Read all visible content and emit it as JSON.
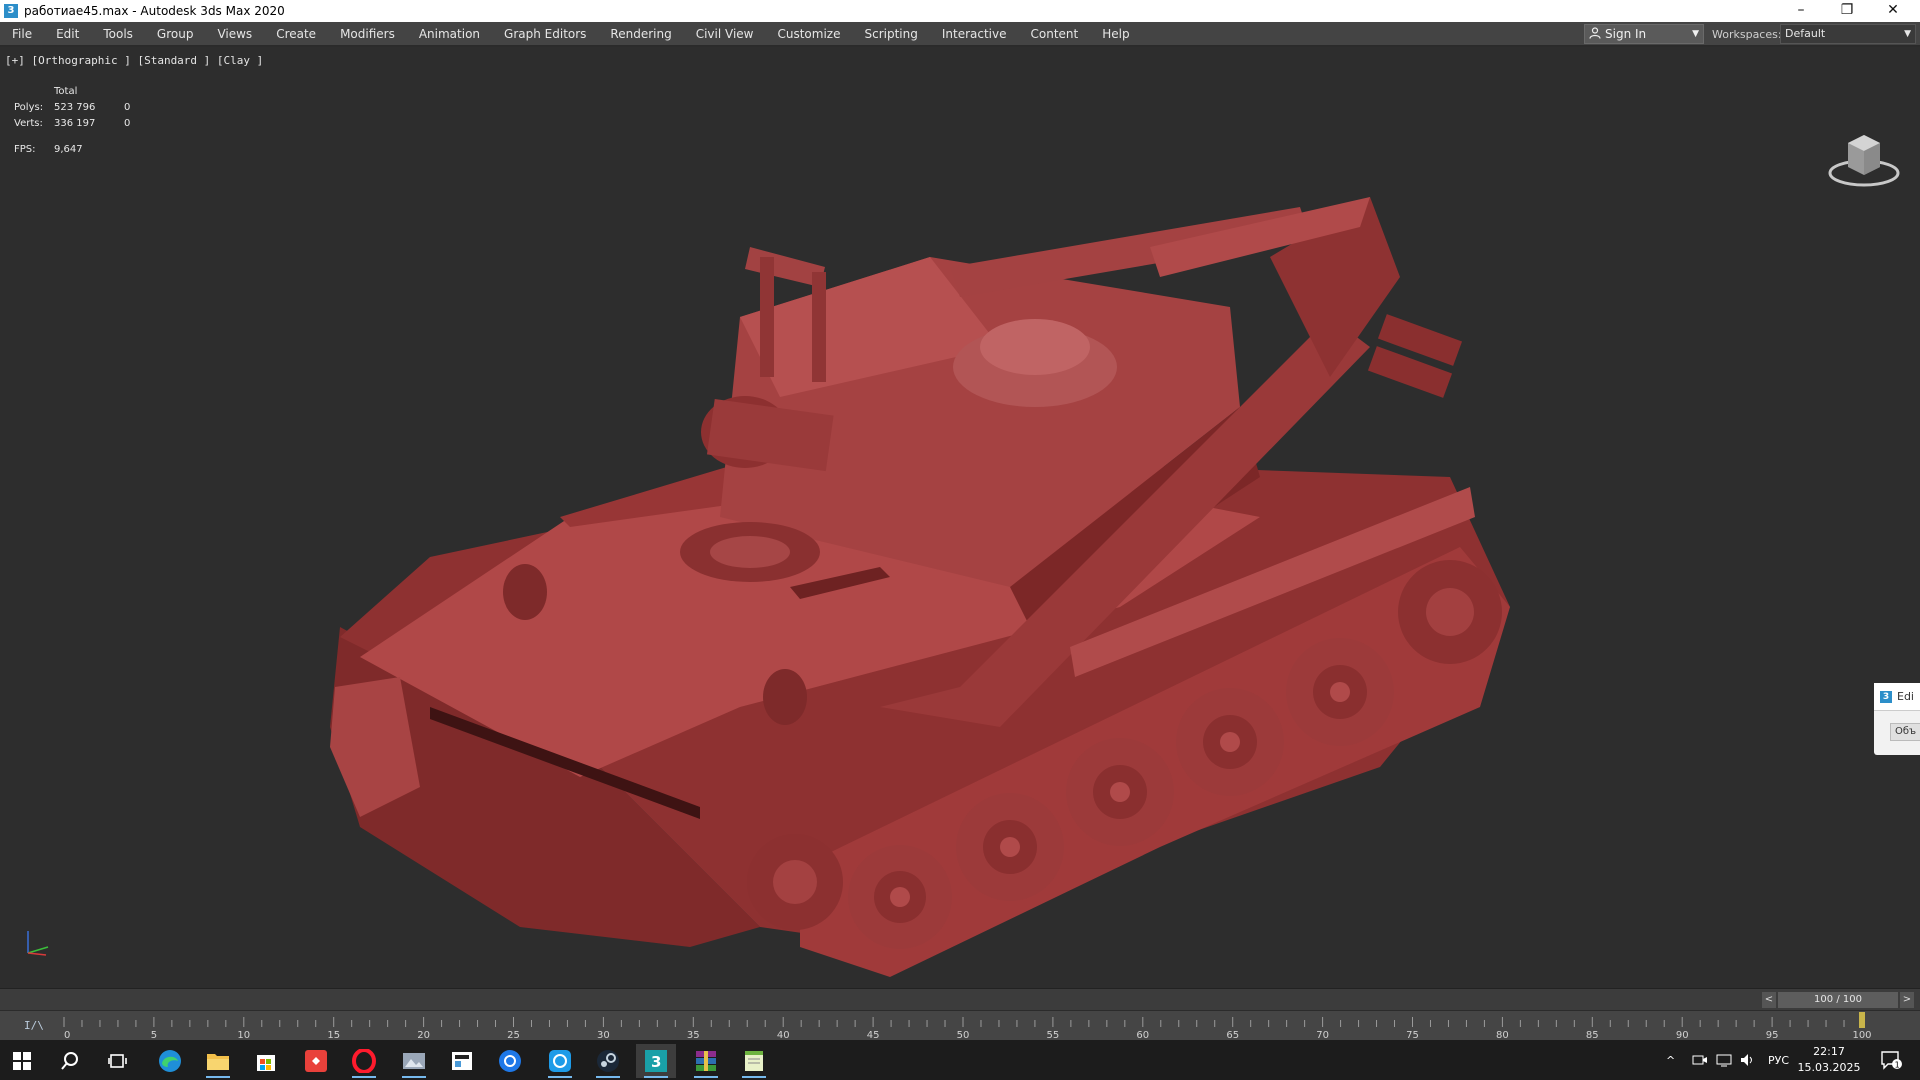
{
  "window": {
    "title": "работиае45.max - Autodesk 3ds Max 2020",
    "minimize_glyph": "–",
    "restore_glyph": "❐",
    "close_glyph": "✕"
  },
  "menu": {
    "items": [
      "File",
      "Edit",
      "Tools",
      "Group",
      "Views",
      "Create",
      "Modifiers",
      "Animation",
      "Graph Editors",
      "Rendering",
      "Civil View",
      "Customize",
      "Scripting",
      "Interactive",
      "Content",
      "Help"
    ]
  },
  "account": {
    "sign_in": "Sign In"
  },
  "workspace": {
    "label": "Workspaces:",
    "value": "Default"
  },
  "viewport": {
    "label": "[+] [Orthographic ] [Standard ] [Clay ]",
    "stats": {
      "header": "Total",
      "polys_label": "Polys:",
      "polys_value": "523 796",
      "polys_sel": "0",
      "verts_label": "Verts:",
      "verts_value": "336 197",
      "verts_sel": "0",
      "fps_label": "FPS:",
      "fps_value": "9,647"
    },
    "model_color": "#9e3535"
  },
  "edit_popup": {
    "title": "Edi",
    "button": "Объ"
  },
  "time_slider": {
    "prev": "<",
    "value": "100 / 100",
    "next": ">"
  },
  "trackbar": {
    "icon": "I/\\",
    "ticks": [
      "0",
      "5",
      "10",
      "15",
      "20",
      "25",
      "30",
      "35",
      "40",
      "45",
      "50",
      "55",
      "60",
      "65",
      "70",
      "75",
      "80",
      "85",
      "90",
      "95",
      "100"
    ],
    "current_frame": 100,
    "max_frame": 100
  },
  "taskbar": {
    "apps": [
      "windows-start-icon",
      "search-icon",
      "task-view-icon",
      "edge-icon",
      "file-explorer-icon",
      "store-icon",
      "anydesk-icon",
      "opera-icon",
      "photos-icon",
      "news-icon",
      "app-blue-icon",
      "qq-icon",
      "steam-icon",
      "3dsmax-icon",
      "winrar-icon",
      "notepad-icon"
    ],
    "tray": {
      "chevron": "^",
      "lang": "РУС"
    },
    "time": "22:17",
    "date": "15.03.2025",
    "notifications": "1"
  }
}
